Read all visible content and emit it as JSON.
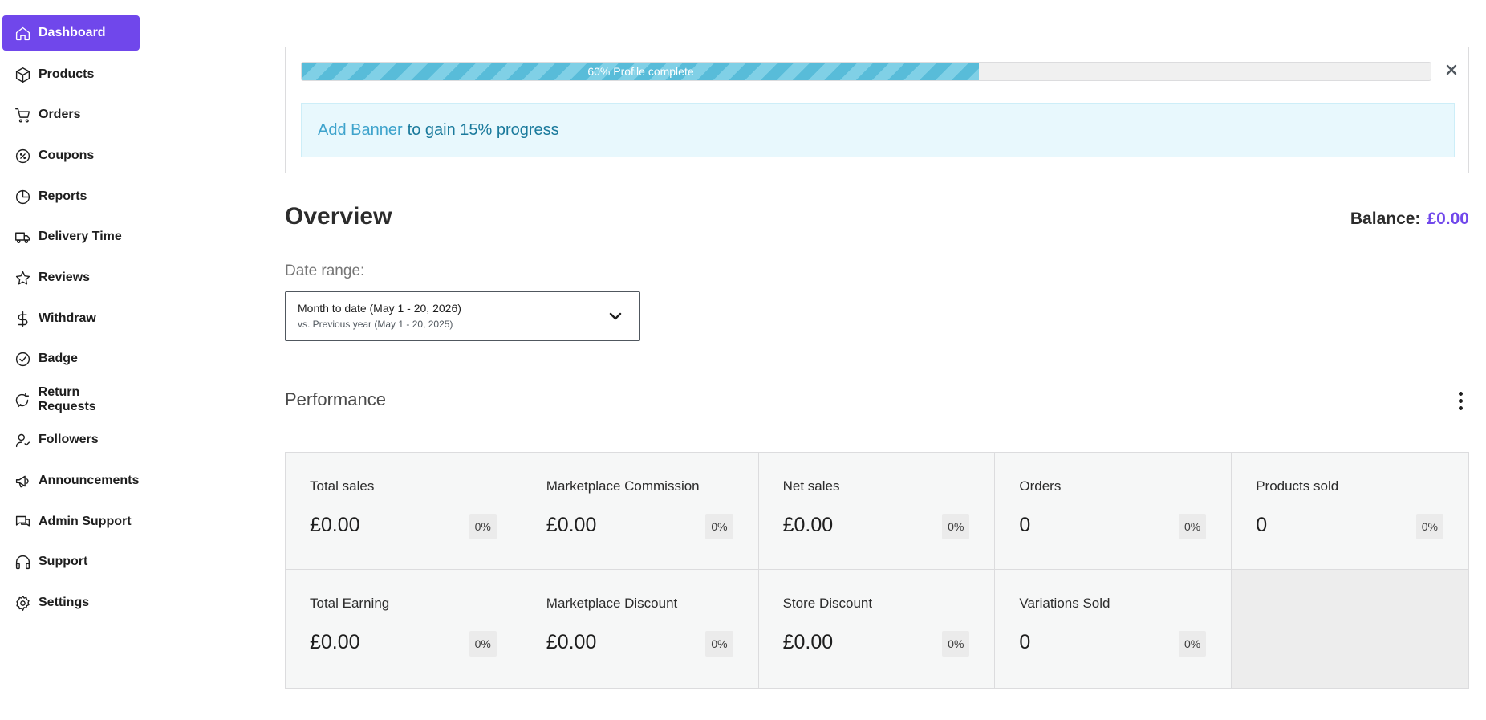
{
  "sidebar": {
    "items": [
      {
        "label": "Dashboard",
        "icon": "home-icon",
        "active": true
      },
      {
        "label": "Products",
        "icon": "box-icon"
      },
      {
        "label": "Orders",
        "icon": "cart-icon"
      },
      {
        "label": "Coupons",
        "icon": "coupon-icon"
      },
      {
        "label": "Reports",
        "icon": "pie-chart-icon"
      },
      {
        "label": "Delivery Time",
        "icon": "truck-icon"
      },
      {
        "label": "Reviews",
        "icon": "star-icon"
      },
      {
        "label": "Withdraw",
        "icon": "dollar-icon"
      },
      {
        "label": "Badge",
        "icon": "badge-check-icon"
      },
      {
        "label": "Return Requests",
        "icon": "return-icon"
      },
      {
        "label": "Followers",
        "icon": "followers-icon"
      },
      {
        "label": "Announcements",
        "icon": "megaphone-icon"
      },
      {
        "label": "Admin Support",
        "icon": "chat-icon"
      },
      {
        "label": "Support",
        "icon": "headphones-icon"
      },
      {
        "label": "Settings",
        "icon": "gear-icon"
      }
    ]
  },
  "progress": {
    "percent": 60,
    "label": "60% Profile complete",
    "notice_link": "Add Banner",
    "notice_text": "to gain 15% progress"
  },
  "overview": {
    "title": "Overview",
    "balance_label": "Balance:",
    "balance_value": "£0.00"
  },
  "date_range": {
    "label": "Date range:",
    "main": "Month to date (May 1 - 20, 2026)",
    "sub": "vs. Previous year (May 1 - 20, 2025)"
  },
  "performance": {
    "title": "Performance",
    "cards": [
      {
        "label": "Total sales",
        "value": "£0.00",
        "delta": "0%"
      },
      {
        "label": "Marketplace Commission",
        "value": "£0.00",
        "delta": "0%"
      },
      {
        "label": "Net sales",
        "value": "£0.00",
        "delta": "0%"
      },
      {
        "label": "Orders",
        "value": "0",
        "delta": "0%"
      },
      {
        "label": "Products sold",
        "value": "0",
        "delta": "0%"
      },
      {
        "label": "Total Earning",
        "value": "£0.00",
        "delta": "0%"
      },
      {
        "label": "Marketplace Discount",
        "value": "£0.00",
        "delta": "0%"
      },
      {
        "label": "Store Discount",
        "value": "£0.00",
        "delta": "0%"
      },
      {
        "label": "Variations Sold",
        "value": "0",
        "delta": "0%"
      }
    ]
  },
  "colors": {
    "accent": "#7047eb",
    "progress": "#58bcd9",
    "notice_bg": "#e8f8fd"
  }
}
